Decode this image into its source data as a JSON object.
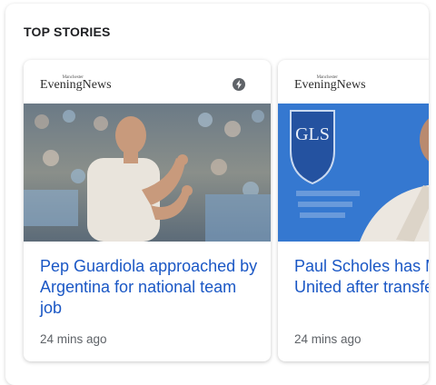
{
  "section": {
    "title": "TOP STORIES"
  },
  "stories": [
    {
      "publisher_small": "Manchester",
      "publisher": "EveningNews",
      "headline": "Pep Guardiola approached by Argentina for national team job",
      "time": "24 mins ago",
      "has_amp_icon": true
    },
    {
      "publisher_small": "Manchester",
      "publisher": "EveningNews",
      "headline": "Paul Scholes has Manchester United after transfer window",
      "time": "24 mins ago",
      "image_sign_text": "GLS"
    }
  ],
  "colors": {
    "headline": "#1a57c5",
    "meta": "#5f6368",
    "sign_blue": "#2f6fc7"
  }
}
